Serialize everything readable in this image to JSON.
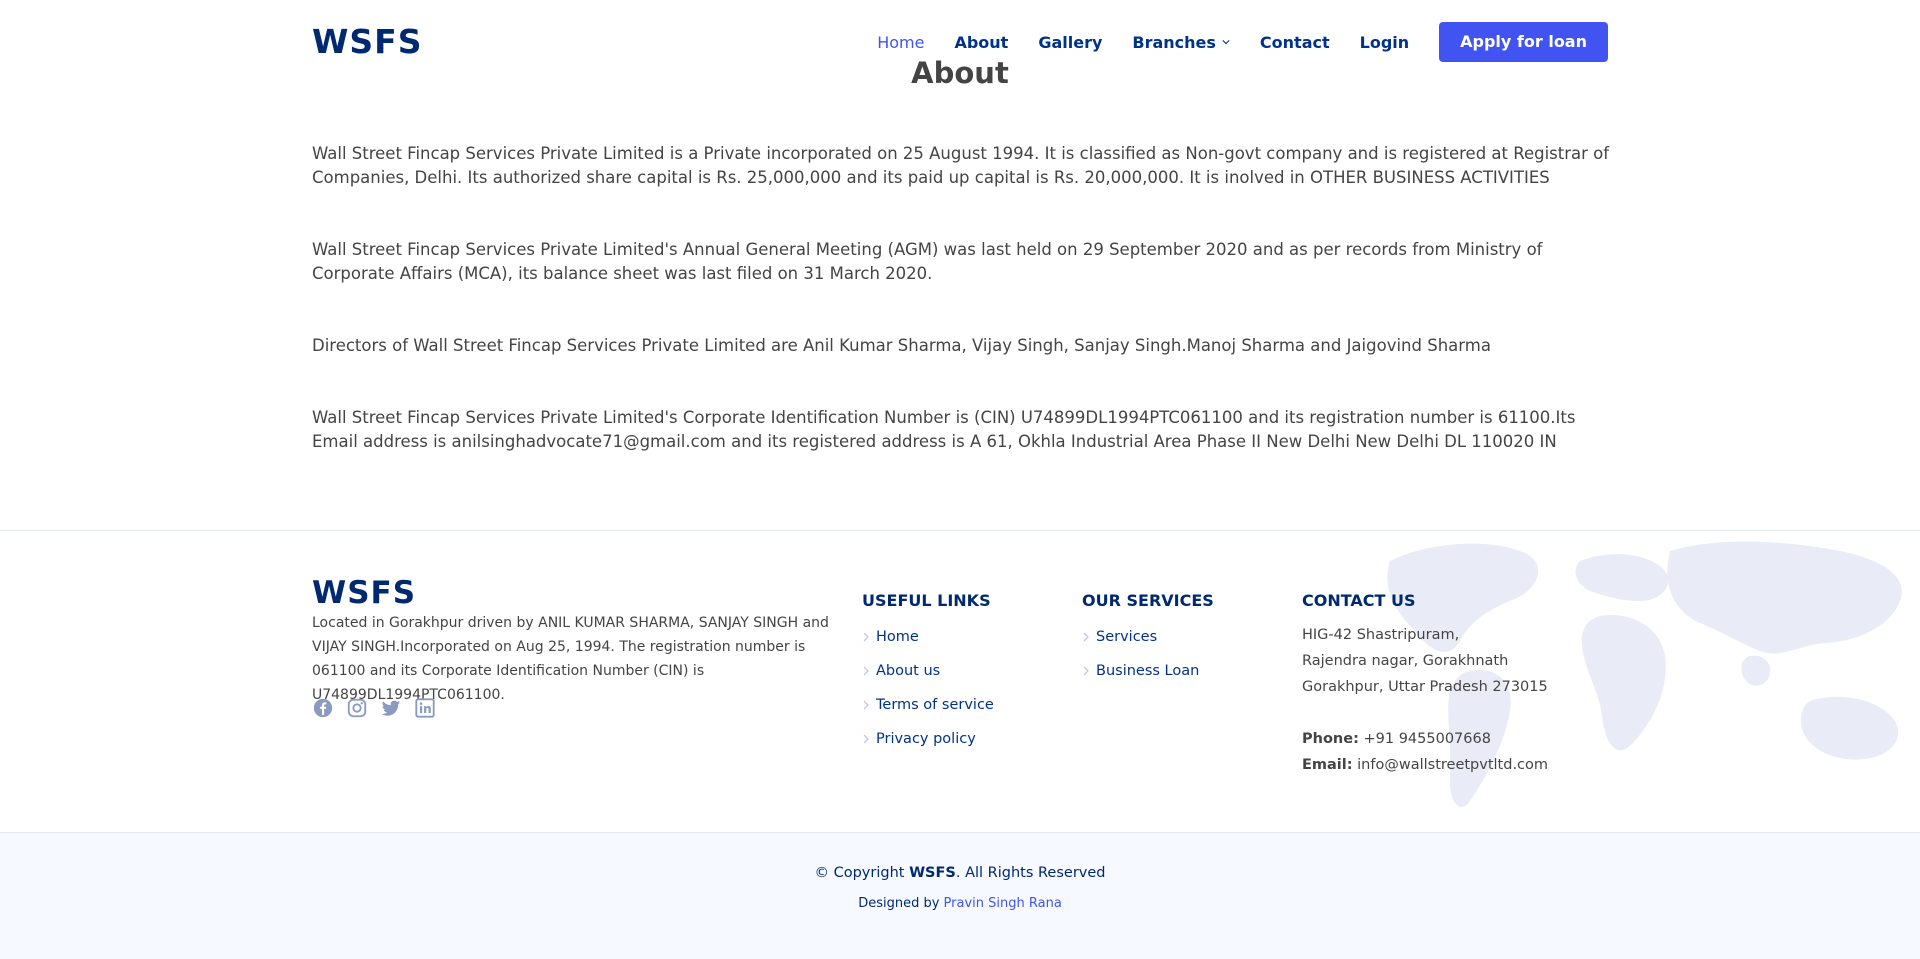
{
  "header": {
    "logo": "WSFS",
    "nav": {
      "home": "Home",
      "about": "About",
      "gallery": "Gallery",
      "branches": "Branches",
      "contact": "Contact",
      "login": "Login"
    },
    "apply_label": "Apply for loan"
  },
  "page_title": "About",
  "about": {
    "paragraphs": [
      "Wall Street Fincap Services Private Limited is a Private incorporated on 25 August 1994. It is classified as Non-govt company and is registered at Registrar of Companies, Delhi. Its authorized share capital is Rs. 25,000,000 and its paid up capital is Rs. 20,000,000. It is inolved in OTHER BUSINESS ACTIVITIES",
      "Wall Street Fincap Services Private Limited's Annual General Meeting (AGM) was last held on 29 September 2020 and as per records from Ministry of Corporate Affairs (MCA), its balance sheet was last filed on 31 March 2020.",
      "Directors of Wall Street Fincap Services Private Limited are Anil Kumar Sharma, Vijay Singh, Sanjay Singh.Manoj Sharma and Jaigovind Sharma",
      "Wall Street Fincap Services Private Limited's Corporate Identification Number is (CIN) U74899DL1994PTC061100 and its registration number is 61100.Its Email address is anilsinghadvocate71@gmail.com and its registered address is A 61, Okhla Industrial Area Phase II New Delhi New Delhi DL 110020 IN"
    ]
  },
  "footer": {
    "logo": "WSFS",
    "description": "Located in Gorakhpur driven by ANIL KUMAR SHARMA, SANJAY SINGH and VIJAY SINGH.Incorporated on Aug 25, 1994. The registration number is 061100 and its Corporate Identification Number (CIN) is U74899DL1994PTC061100.",
    "socials": [
      "facebook-icon",
      "instagram-icon",
      "twitter-icon",
      "linkedin-icon"
    ],
    "useful_links": {
      "title": "USEFUL LINKS",
      "items": [
        "Home",
        "About us",
        "Terms of service",
        "Privacy policy"
      ]
    },
    "services": {
      "title": "OUR SERVICES",
      "items": [
        "Services",
        "Business Loan"
      ]
    },
    "contact": {
      "title": "CONTACT US",
      "address1": "HIG-42 Shastripuram,",
      "address2": "Rajendra nagar, Gorakhnath",
      "address3": "Gorakhpur, Uttar Pradesh 273015",
      "phone_label": "Phone:",
      "phone": "+91 9455007668",
      "email_label": "Email:",
      "email": "info@wallstreetpvtltd.com"
    }
  },
  "copyright": {
    "prefix": "© Copyright",
    "brand": "WSFS",
    "suffix": ". All Rights Reserved",
    "designed_by": "Designed by",
    "designer": "Pravin Singh Rana"
  },
  "colors": {
    "brand": "#012970",
    "accent": "#4154f1",
    "text": "#444444",
    "footer_bg": "#f6f9ff"
  }
}
